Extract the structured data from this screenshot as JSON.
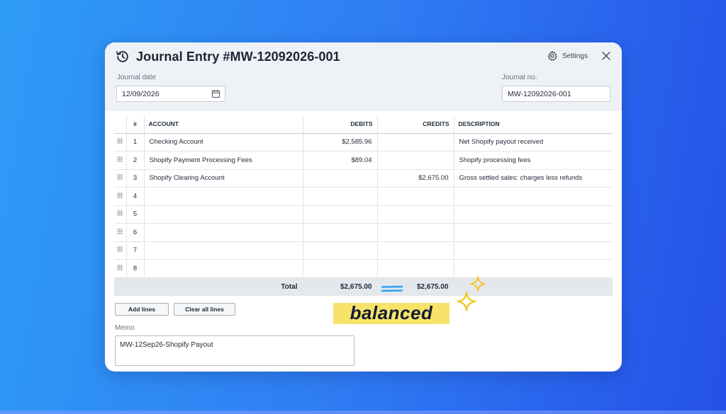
{
  "window": {
    "title": "Journal Entry #MW-12092026-001",
    "settings_label": "Settings"
  },
  "form": {
    "journal_date_label": "Journal date",
    "journal_date_value": "12/09/2026",
    "journal_no_label": "Journal no.",
    "journal_no_value": "MW-12092026-001"
  },
  "table": {
    "headers": [
      "#",
      "ACCOUNT",
      "DEBITS",
      "CREDITS",
      "DESCRIPTION"
    ],
    "rows": [
      {
        "num": "1",
        "account": "Checking Account",
        "debit": "$2,585.96",
        "credit": "",
        "description": "Net Shopify payout received"
      },
      {
        "num": "2",
        "account": "Shopify Payment Processing Fees",
        "debit": "$89.04",
        "credit": "",
        "description": "Shopify processing fees"
      },
      {
        "num": "3",
        "account": "Shopify Clearing Account",
        "debit": "",
        "credit": "$2,675.00",
        "description": "Gross settled sales: charges less refunds"
      },
      {
        "num": "4",
        "account": "",
        "debit": "",
        "credit": "",
        "description": ""
      },
      {
        "num": "5",
        "account": "",
        "debit": "",
        "credit": "",
        "description": ""
      },
      {
        "num": "6",
        "account": "",
        "debit": "",
        "credit": "",
        "description": ""
      },
      {
        "num": "7",
        "account": "",
        "debit": "",
        "credit": "",
        "description": ""
      },
      {
        "num": "8",
        "account": "",
        "debit": "",
        "credit": "",
        "description": ""
      }
    ],
    "total_label": "Total",
    "total_debits": "$2,675.00",
    "total_credits": "$2,675.00"
  },
  "actions": {
    "add_lines": "Add lines",
    "clear_all_lines": "Clear all lines"
  },
  "memo": {
    "label": "Memo",
    "value": "MW-12Sep26-Shopify Payout"
  },
  "badge": {
    "text": "balanced"
  },
  "colors": {
    "background_start": "#2e9cf6",
    "background_end": "#2551e8",
    "badge_yellow": "#f8e36a",
    "sparkle_yellow": "#f2c81e",
    "equals_blue": "#29a3ef"
  },
  "icons": {
    "title": "history-icon",
    "settings": "gear-icon",
    "close": "close-icon",
    "date": "calendar-icon",
    "row_handle": "drag-handle-icon",
    "equals": "equals-icon",
    "sparkle": "sparkle-icon"
  }
}
